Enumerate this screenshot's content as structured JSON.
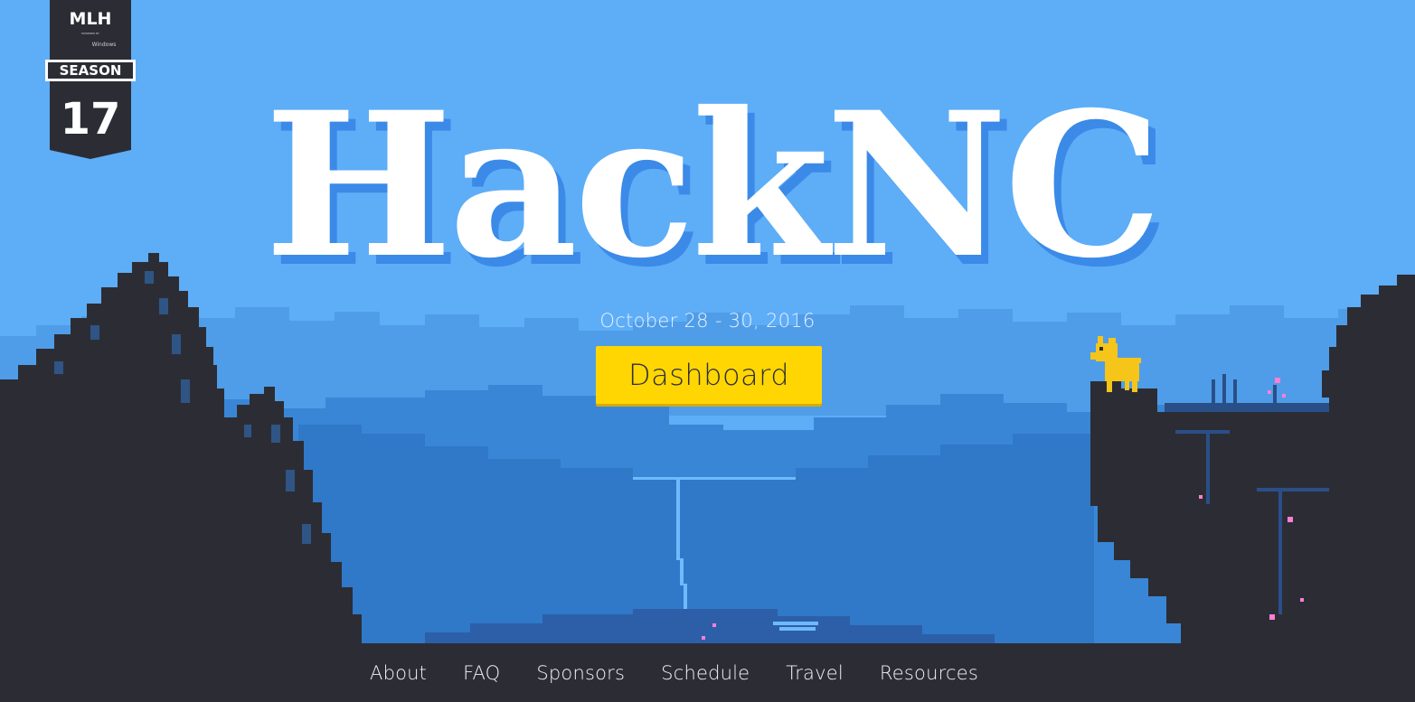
{
  "badge": {
    "org": "MLH",
    "powered_by": "POWERED BY",
    "partner": "Windows",
    "label": "SEASON",
    "number": "17"
  },
  "hero": {
    "title": "HackNC",
    "date": "October 28 - 30, 2016",
    "cta_label": "Dashboard"
  },
  "nav": {
    "items": [
      "About",
      "FAQ",
      "Sponsors",
      "Schedule",
      "Travel",
      "Resources"
    ]
  },
  "colors": {
    "sky": "#5eadf7",
    "cloud": "#4f9de8",
    "mountain": "#3a86d6",
    "valley": "#3078c8",
    "dark": "#2c2d34",
    "cta": "#ffd602",
    "mascot": "#f5c519"
  },
  "icons": [
    "mlh-logo-icon",
    "goat-mascot-icon",
    "waterfall-icon"
  ]
}
